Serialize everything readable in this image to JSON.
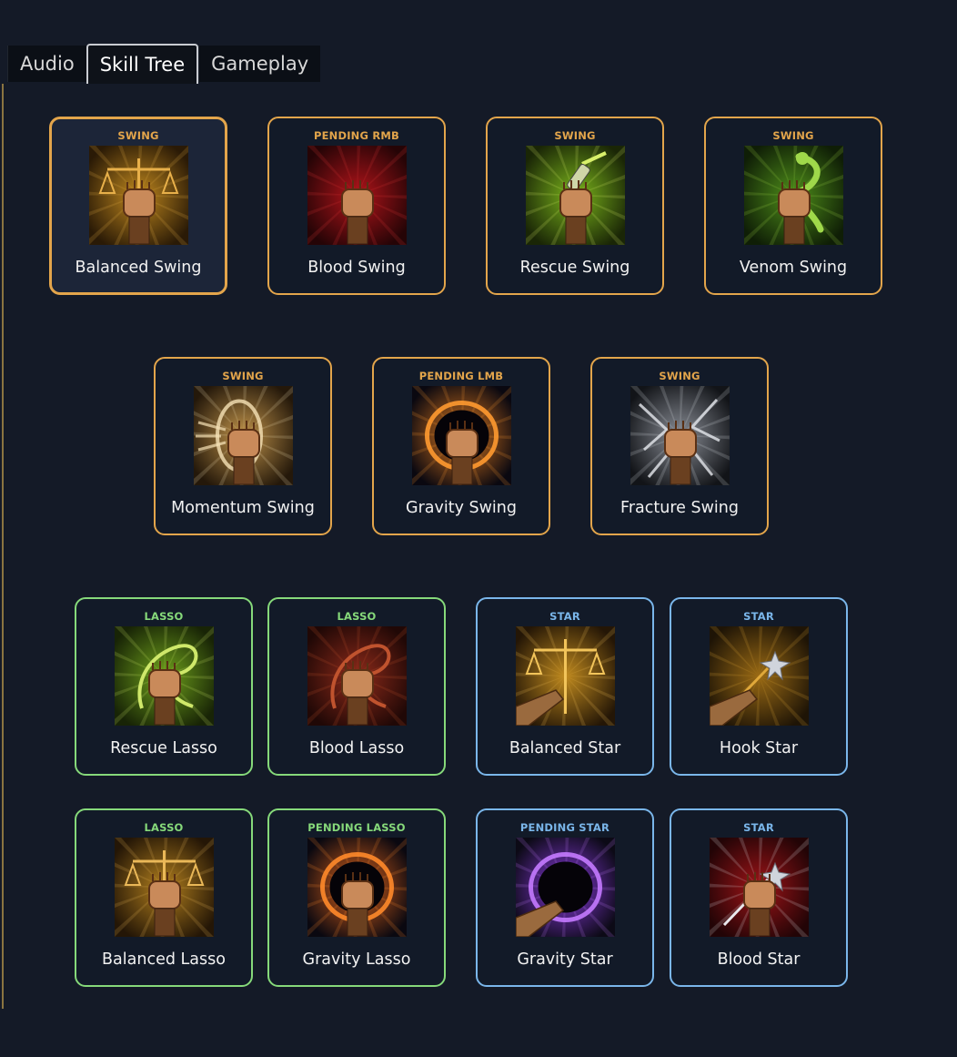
{
  "tabs": [
    "Audio",
    "Skill Tree",
    "Gameplay"
  ],
  "active_tab": "Skill Tree",
  "colors": {
    "swing": "#e3a54b",
    "lasso": "#86d97a",
    "star": "#7ab6ea",
    "background": "#141a27"
  },
  "skills": [
    {
      "tag": "SWING",
      "name": "Balanced Swing",
      "type": "swing",
      "selected": true,
      "icon": "balanced-swing-icon",
      "glow": "#c0881e",
      "dark": "#2a1a06",
      "accent": "#e8b04a"
    },
    {
      "tag": "PENDING RMB",
      "name": "Blood Swing",
      "type": "swing",
      "icon": "blood-swing-icon",
      "glow": "#b3141a",
      "dark": "#250406",
      "accent": "#e03a3a"
    },
    {
      "tag": "SWING",
      "name": "Rescue Swing",
      "type": "swing",
      "icon": "rescue-swing-icon",
      "glow": "#7bb51c",
      "dark": "#1a2606",
      "accent": "#d8f06a"
    },
    {
      "tag": "SWING",
      "name": "Venom Swing",
      "type": "swing",
      "icon": "venom-swing-icon",
      "glow": "#4f8f1a",
      "dark": "#0f1e06",
      "accent": "#9fd84a"
    },
    {
      "tag": "SWING",
      "name": "Momentum Swing",
      "type": "swing",
      "icon": "momentum-swing-icon",
      "glow": "#c0934a",
      "dark": "#24180a",
      "accent": "#f6e2b6"
    },
    {
      "tag": "PENDING LMB",
      "name": "Gravity Swing",
      "type": "swing",
      "icon": "gravity-swing-icon",
      "glow": "#e07a1e",
      "dark": "#0a0810",
      "accent": "#ff9a30"
    },
    {
      "tag": "SWING",
      "name": "Fracture Swing",
      "type": "swing",
      "icon": "fracture-swing-icon",
      "glow": "#8a8e96",
      "dark": "#121418",
      "accent": "#e6e8ee"
    },
    {
      "tag": "LASSO",
      "name": "Rescue Lasso",
      "type": "lasso",
      "icon": "rescue-lasso-icon",
      "glow": "#6fa21c",
      "dark": "#182406",
      "accent": "#cfe86a"
    },
    {
      "tag": "LASSO",
      "name": "Blood Lasso",
      "type": "lasso",
      "icon": "blood-lasso-icon",
      "glow": "#8e2a1a",
      "dark": "#200806",
      "accent": "#c0532e"
    },
    {
      "tag": "STAR",
      "name": "Balanced Star",
      "type": "star",
      "icon": "balanced-star-icon",
      "glow": "#c08a1e",
      "dark": "#241606",
      "accent": "#f2c45a"
    },
    {
      "tag": "STAR",
      "name": "Hook Star",
      "type": "star",
      "icon": "hook-star-icon",
      "glow": "#9a6a14",
      "dark": "#1e1406",
      "accent": "#e0a83a"
    },
    {
      "tag": "LASSO",
      "name": "Balanced Lasso",
      "type": "lasso",
      "icon": "balanced-lasso-icon",
      "glow": "#b3801e",
      "dark": "#241606",
      "accent": "#eab858"
    },
    {
      "tag": "PENDING LASSO",
      "name": "Gravity Lasso",
      "type": "lasso",
      "icon": "gravity-lasso-icon",
      "glow": "#e0641a",
      "dark": "#0a0810",
      "accent": "#ff8a2a"
    },
    {
      "tag": "PENDING STAR",
      "name": "Gravity Star",
      "type": "star",
      "icon": "gravity-star-icon",
      "glow": "#8a3ae0",
      "dark": "#0c0a16",
      "accent": "#c47aff"
    },
    {
      "tag": "STAR",
      "name": "Blood Star",
      "type": "star",
      "icon": "blood-star-icon",
      "glow": "#a01418",
      "dark": "#220406",
      "accent": "#e8e8ec"
    }
  ]
}
